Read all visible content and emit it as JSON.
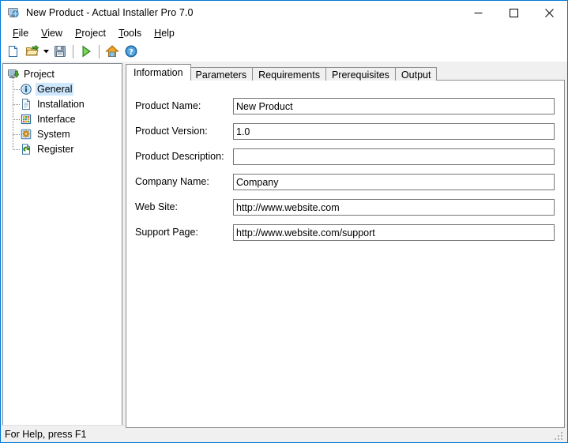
{
  "window": {
    "title": "New Product - Actual Installer Pro 7.0",
    "icon": "app-installer-icon",
    "border_color": "#0078d7",
    "controls": [
      {
        "name": "minimize-button",
        "glyph": "minimize-icon"
      },
      {
        "name": "maximize-button",
        "glyph": "maximize-icon"
      },
      {
        "name": "close-button",
        "glyph": "close-icon"
      }
    ]
  },
  "menubar": {
    "items": [
      {
        "label": "File",
        "accel": "F",
        "rest": "ile"
      },
      {
        "label": "View",
        "accel": "V",
        "rest": "iew"
      },
      {
        "label": "Project",
        "accel": "P",
        "rest": "roject"
      },
      {
        "label": "Tools",
        "accel": "T",
        "rest": "ools"
      },
      {
        "label": "Help",
        "accel": "H",
        "rest": "elp"
      }
    ]
  },
  "toolbar": {
    "buttons": [
      {
        "name": "new-project-button",
        "icon": "new-document-icon",
        "tip": "New"
      },
      {
        "name": "open-project-button",
        "icon": "open-folder-icon",
        "tip": "Open"
      },
      {
        "name": "open-recent-dropdown",
        "icon": "chevron-down-icon",
        "tip": "Recent"
      },
      {
        "name": "save-project-button",
        "icon": "save-floppy-icon",
        "tip": "Save"
      },
      {
        "name": "build-project-button",
        "icon": "play-green-triangle-icon",
        "tip": "Build"
      },
      {
        "name": "home-button",
        "icon": "home-icon",
        "tip": "Home"
      },
      {
        "name": "help-button",
        "icon": "help-question-icon",
        "tip": "Help"
      }
    ]
  },
  "sidebar": {
    "root": {
      "label": "Project",
      "icon": "project-computer-icon"
    },
    "items": [
      {
        "label": "General",
        "icon": "info-circle-icon",
        "selected": true
      },
      {
        "label": "Installation",
        "icon": "document-page-icon",
        "selected": false
      },
      {
        "label": "Interface",
        "icon": "grid-window-icon",
        "selected": false
      },
      {
        "label": "System",
        "icon": "system-gear-icon",
        "selected": false
      },
      {
        "label": "Register",
        "icon": "register-page-icon",
        "selected": false
      }
    ],
    "selection_color": "#cde8ff"
  },
  "tabs": {
    "items": [
      {
        "label": "Information",
        "active": true
      },
      {
        "label": "Parameters",
        "active": false
      },
      {
        "label": "Requirements",
        "active": false
      },
      {
        "label": "Prerequisites",
        "active": false
      },
      {
        "label": "Output",
        "active": false
      }
    ]
  },
  "form": {
    "fields": [
      {
        "name": "product-name",
        "label": "Product Name:",
        "value": "New Product",
        "placeholder": ""
      },
      {
        "name": "product-version",
        "label": "Product Version:",
        "value": "1.0",
        "placeholder": ""
      },
      {
        "name": "product-description",
        "label": "Product Description:",
        "value": "",
        "placeholder": ""
      },
      {
        "name": "company-name",
        "label": "Company Name:",
        "value": "Company",
        "placeholder": ""
      },
      {
        "name": "web-site",
        "label": "Web Site:",
        "value": "http://www.website.com",
        "placeholder": ""
      },
      {
        "name": "support-page",
        "label": "Support Page:",
        "value": "http://www.website.com/support",
        "placeholder": ""
      }
    ]
  },
  "statusbar": {
    "text": "For Help, press F1"
  }
}
